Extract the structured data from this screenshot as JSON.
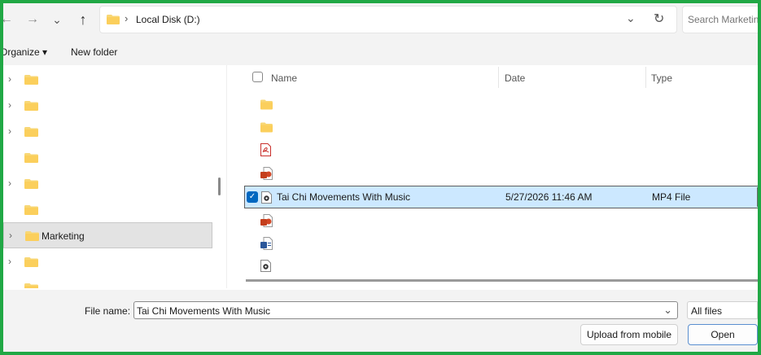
{
  "nav": {
    "back": "←",
    "forward": "→",
    "recent": "⌄",
    "up": "↑"
  },
  "address": {
    "separator": "›",
    "path": "Local Disk (D:)",
    "dropdown": "⌄",
    "refresh": "↻"
  },
  "search": {
    "placeholder": "Search Marketing"
  },
  "commands": {
    "organize": "Organize ▾",
    "new_folder": "New folder"
  },
  "tree": {
    "chevron": "›",
    "items": [
      {
        "label": ""
      },
      {
        "label": ""
      },
      {
        "label": ""
      },
      {
        "label": ""
      },
      {
        "label": ""
      },
      {
        "label": ""
      },
      {
        "label": "Marketing"
      },
      {
        "label": ""
      },
      {
        "label": ""
      }
    ]
  },
  "columns": {
    "name": "Name",
    "date": "Date",
    "type": "Type",
    "sort_indicator": "ˇ"
  },
  "files": [
    {
      "name": "",
      "date": "",
      "type": "",
      "icon": "folder-icon"
    },
    {
      "name": "",
      "date": "",
      "type": "",
      "icon": "folder-icon"
    },
    {
      "name": "",
      "date": "",
      "type": "",
      "icon": "pdf-icon"
    },
    {
      "name": "",
      "date": "",
      "type": "",
      "icon": "powerpoint-icon"
    },
    {
      "name": "Tai Chi Movements With Music",
      "date": "5/27/2026 11:46 AM",
      "type": "MP4 File",
      "icon": "video-file-icon",
      "selected": true
    },
    {
      "name": "",
      "date": "",
      "type": "",
      "icon": "powerpoint-icon"
    },
    {
      "name": "",
      "date": "",
      "type": "",
      "icon": "word-icon"
    },
    {
      "name": "",
      "date": "",
      "type": "",
      "icon": "video-file-icon"
    }
  ],
  "selected_check": "✓",
  "bottom": {
    "file_name_label": "File name:",
    "file_name_value": "Tai Chi Movements With Music",
    "file_name_dropdown": "⌄",
    "file_type": "All files",
    "upload_button": "Upload from mobile",
    "open_button": "Open"
  },
  "colors": {
    "frame_border": "#21a845",
    "selection": "#cce8ff",
    "accent": "#0067c0",
    "folder": "#f8d775"
  }
}
